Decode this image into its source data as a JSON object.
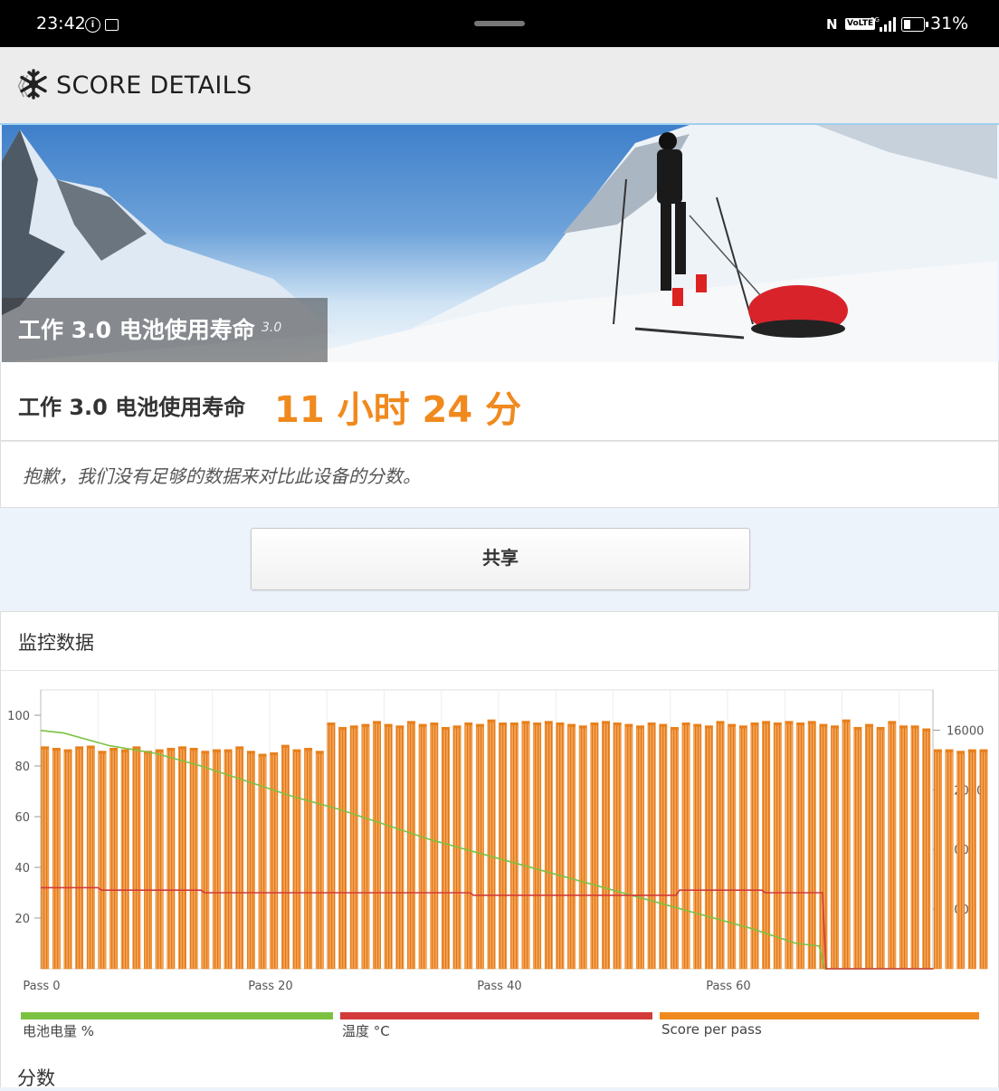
{
  "status_bar": {
    "time": "23:42",
    "battery_percent": "31%",
    "nfc": "N",
    "volte": "VoLTE",
    "network": "5G",
    "icons": [
      "info-icon",
      "cast-icon",
      "nfc-icon",
      "volte-icon",
      "signal-icon",
      "battery-icon"
    ]
  },
  "app_bar": {
    "back_glyph": "《",
    "logo": "snowflake-icon",
    "title": "SCORE DETAILS"
  },
  "hero": {
    "caption": "工作 3.0 电池使用寿命",
    "version": "3.0"
  },
  "result": {
    "label": "工作 3.0 电池使用寿命",
    "score": "11 小时 24 分",
    "score_color": "#f08a1e"
  },
  "notice": "抱歉，我们没有足够的数据来对比此设备的分数。",
  "share_button": "共享",
  "monitoring": {
    "title": "监控数据"
  },
  "legend": [
    {
      "label": "电池电量 %",
      "color": "#7cc242"
    },
    {
      "label": "温度 °C",
      "color": "#d33a3a"
    },
    {
      "label": "Score per pass",
      "color": "#f08a1e"
    }
  ],
  "score_section_title": "分数",
  "chart_data": {
    "type": "bar",
    "x_ticks": [
      "Pass 0",
      "Pass 20",
      "Pass 40",
      "Pass 60"
    ],
    "x_tick_values": [
      0,
      20,
      40,
      60
    ],
    "y_left": {
      "ticks": [
        "100",
        "80",
        "60",
        "40",
        "20"
      ],
      "tick_values": [
        100,
        80,
        60,
        40,
        20
      ],
      "range": [
        0,
        110
      ]
    },
    "y_right": {
      "ticks": [
        "16000",
        "12000",
        "8000",
        "4000"
      ],
      "tick_values": [
        16000,
        12000,
        8000,
        4000
      ],
      "range": [
        0,
        18700
      ]
    },
    "grid": true,
    "legend_placement": "bottom",
    "series": [
      {
        "name": "Score per pass",
        "axis": "right",
        "color": "#f08a1e",
        "values": [
          14900,
          14800,
          14700,
          14900,
          14950,
          14600,
          14800,
          14700,
          14900,
          14600,
          14700,
          14800,
          14900,
          14800,
          14600,
          14700,
          14700,
          14900,
          14600,
          14400,
          14500,
          15000,
          14700,
          14800,
          14600,
          16500,
          16200,
          16300,
          16400,
          16600,
          16400,
          16300,
          16600,
          16400,
          16500,
          16200,
          16300,
          16500,
          16400,
          16700,
          16500,
          16500,
          16600,
          16500,
          16600,
          16500,
          16400,
          16300,
          16500,
          16600,
          16500,
          16400,
          16300,
          16500,
          16400,
          16200,
          16500,
          16400,
          16300,
          16600,
          16400,
          16300,
          16500,
          16600,
          16500,
          16600,
          16500,
          16600,
          16400,
          16300,
          16700,
          16200,
          16400,
          16200,
          16600,
          16300,
          16300,
          16100,
          14700,
          14700,
          14600,
          14700,
          14700
        ]
      },
      {
        "name": "电池电量 %",
        "axis": "left",
        "color": "#7cc242",
        "x": [
          0,
          2,
          6,
          10,
          14,
          18,
          22,
          26,
          30,
          34,
          38,
          42,
          46,
          50,
          54,
          58,
          62,
          66,
          68,
          68.5,
          70.5,
          78
        ],
        "values": [
          94,
          93,
          88,
          85,
          80,
          74,
          68,
          63,
          57,
          51,
          46,
          41,
          36,
          31,
          26,
          21,
          16,
          10,
          9,
          0,
          0,
          0
        ]
      },
      {
        "name": "温度 °C",
        "axis": "left",
        "color": "#d33a3a",
        "x": [
          0,
          5,
          5.3,
          14,
          14.3,
          37.5,
          37.8,
          55.5,
          55.8,
          63,
          63.3,
          68.3,
          68.6,
          78
        ],
        "values": [
          32,
          32,
          31,
          31,
          30,
          30,
          29,
          29,
          31,
          31,
          30,
          30,
          0,
          0
        ]
      }
    ]
  }
}
